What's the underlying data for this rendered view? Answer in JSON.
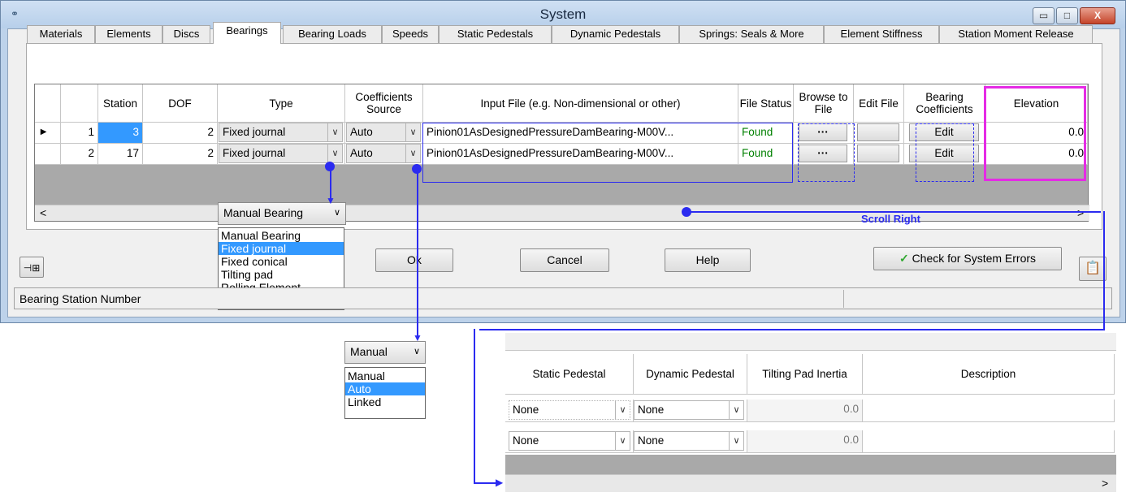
{
  "window": {
    "title": "System",
    "buttons": {
      "minimize": "▭",
      "maximize": "□",
      "close": "X"
    }
  },
  "tabs": [
    "Materials",
    "Elements",
    "Discs",
    "Bearings",
    "Bearing Loads",
    "Speeds",
    "Static Pedestals",
    "Dynamic Pedestals",
    "Springs: Seals & More",
    "Element Stiffness",
    "Station Moment Release"
  ],
  "grid": {
    "headers": {
      "station": "Station",
      "dof": "DOF",
      "type": "Type",
      "coef_source": "Coefficients Source",
      "input_file": "Input File (e.g. Non-dimensional or other)",
      "file_status": "File Status",
      "browse": "Browse to File",
      "edit_file": "Edit File",
      "bearing_coef": "Bearing Coefficients",
      "elevation": "Elevation"
    },
    "rows": [
      {
        "index": "1",
        "station": "3",
        "dof": "2",
        "type": "Fixed journal",
        "coef_source": "Auto",
        "input_file": "Pinion01AsDesignedPressureDamBearing-M00V...",
        "file_status": "Found",
        "browse": "···",
        "coef_btn": "Edit",
        "elevation": "0.0"
      },
      {
        "index": "2",
        "station": "17",
        "dof": "2",
        "type": "Fixed journal",
        "coef_source": "Auto",
        "input_file": "Pinion01AsDesignedPressureDamBearing-M00V...",
        "file_status": "Found",
        "browse": "···",
        "coef_btn": "Edit",
        "elevation": "0.0"
      }
    ],
    "scroll_left": "<",
    "scroll_right": ">"
  },
  "type_dropdown": {
    "selected": "Manual Bearing",
    "options": [
      "Manual Bearing",
      "Fixed journal",
      "Fixed conical",
      "Tilting pad",
      "Rolling Element"
    ],
    "highlighted": "Fixed journal"
  },
  "source_dropdown": {
    "selected": "Manual",
    "options": [
      "Manual",
      "Auto",
      "Linked"
    ],
    "highlighted": "Auto"
  },
  "buttons": {
    "ok": "Ok",
    "cancel": "Cancel",
    "help": "Help",
    "check": "Check for System Errors"
  },
  "status_text": "Bearing Station Number",
  "annotation": {
    "scroll_right": "Scroll Right"
  },
  "grid2": {
    "headers": {
      "static": "Static Pedestal",
      "dynamic": "Dynamic Pedestal",
      "tilting": "Tilting Pad Inertia",
      "description": "Description"
    },
    "rows": [
      {
        "static": "None",
        "dynamic": "None",
        "tilting": "0.0",
        "description": ""
      },
      {
        "static": "None",
        "dynamic": "None",
        "tilting": "0.0",
        "description": ""
      }
    ],
    "scroll_right": ">"
  },
  "colors": {
    "annotation_blue": "#2b2bf0",
    "highlight_magenta": "#e52be5",
    "selection": "#3399ff",
    "found_green": "#008000"
  }
}
